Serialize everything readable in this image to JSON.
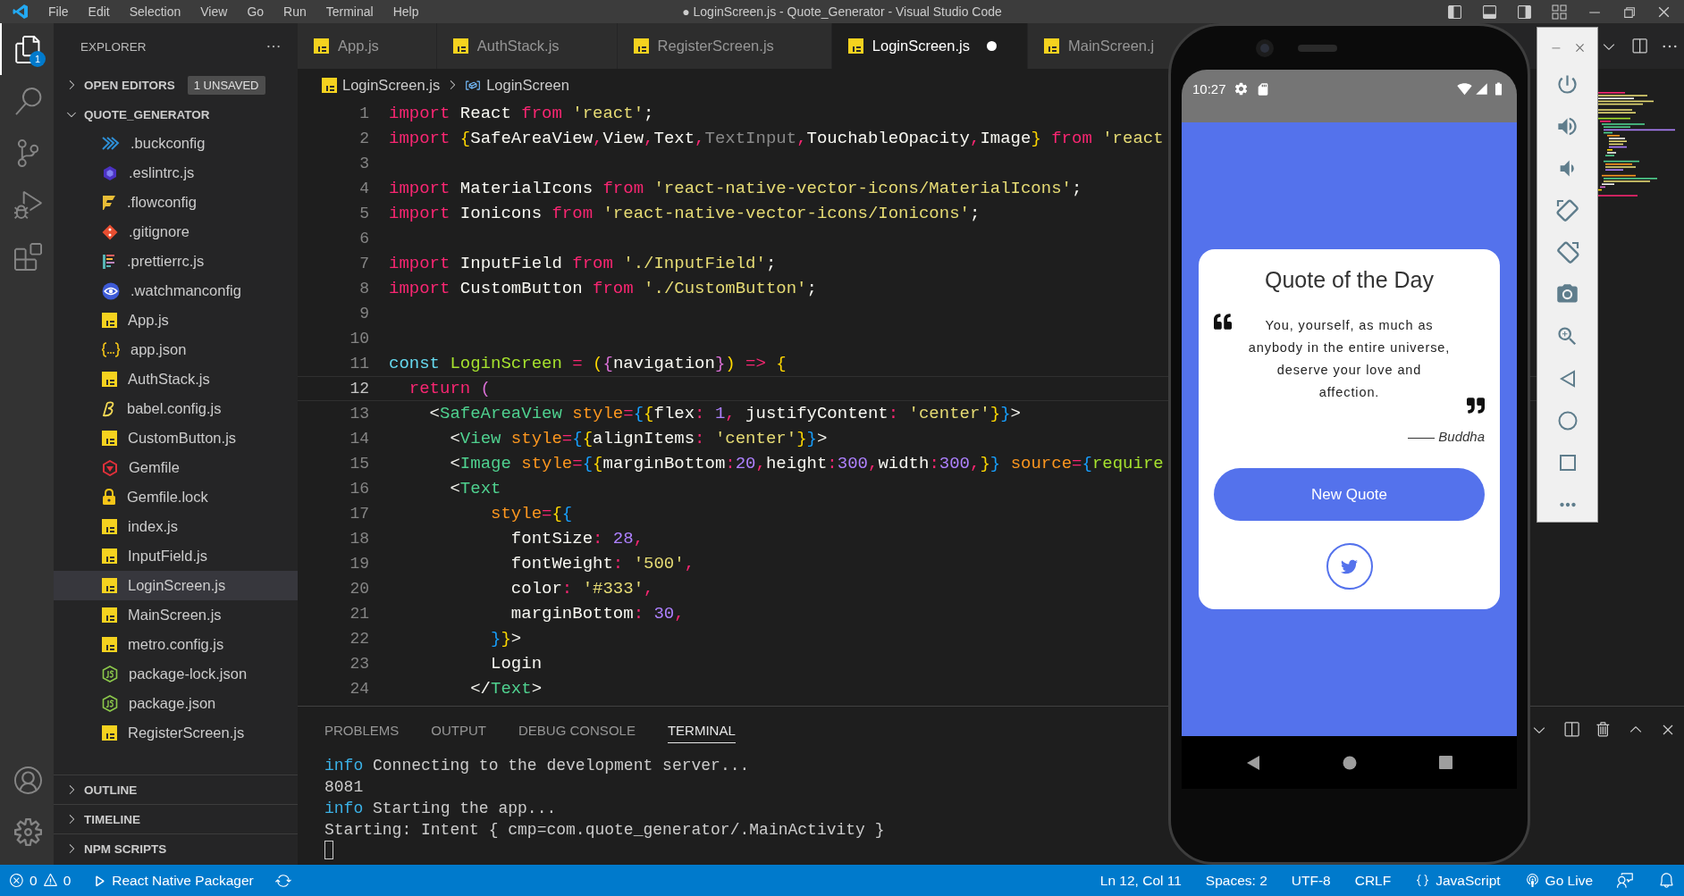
{
  "title_bar": {
    "menu": [
      "File",
      "Edit",
      "Selection",
      "View",
      "Go",
      "Run",
      "Terminal",
      "Help"
    ],
    "title": "● LoginScreen.js - Quote_Generator - Visual Studio Code"
  },
  "activity_bar": {
    "items": [
      {
        "kind": "files",
        "selected": true,
        "badge": "1"
      },
      {
        "kind": "search",
        "selected": false
      },
      {
        "kind": "source-control",
        "selected": false
      },
      {
        "kind": "run",
        "selected": false
      },
      {
        "kind": "extensions",
        "selected": false
      }
    ],
    "bottom": [
      {
        "kind": "account"
      },
      {
        "kind": "settings"
      }
    ]
  },
  "sidebar": {
    "title": "EXPLORER",
    "open_editors": {
      "label": "OPEN EDITORS",
      "expanded": false,
      "badge": "1 UNSAVED"
    },
    "project": {
      "label": "QUOTE_GENERATOR",
      "expanded": true,
      "files": [
        {
          "name": ".buckconfig",
          "kind": "buck",
          "selected": false
        },
        {
          "name": ".eslintrc.js",
          "kind": "eslint",
          "selected": false
        },
        {
          "name": ".flowconfig",
          "kind": "flow",
          "selected": false
        },
        {
          "name": ".gitignore",
          "kind": "git",
          "selected": false
        },
        {
          "name": ".prettierrc.js",
          "kind": "prettier",
          "selected": false
        },
        {
          "name": ".watchmanconfig",
          "kind": "watchman",
          "selected": false
        },
        {
          "name": "App.js",
          "kind": "js",
          "selected": false
        },
        {
          "name": "app.json",
          "kind": "json",
          "selected": false
        },
        {
          "name": "AuthStack.js",
          "kind": "js",
          "selected": false
        },
        {
          "name": "babel.config.js",
          "kind": "babel",
          "selected": false
        },
        {
          "name": "CustomButton.js",
          "kind": "js",
          "selected": false
        },
        {
          "name": "Gemfile",
          "kind": "gem",
          "selected": false
        },
        {
          "name": "Gemfile.lock",
          "kind": "lock",
          "selected": false
        },
        {
          "name": "index.js",
          "kind": "js",
          "selected": false
        },
        {
          "name": "InputField.js",
          "kind": "js",
          "selected": false
        },
        {
          "name": "LoginScreen.js",
          "kind": "js",
          "selected": true
        },
        {
          "name": "MainScreen.js",
          "kind": "js",
          "selected": false
        },
        {
          "name": "metro.config.js",
          "kind": "js",
          "selected": false
        },
        {
          "name": "package-lock.json",
          "kind": "npm",
          "selected": false
        },
        {
          "name": "package.json",
          "kind": "npm",
          "selected": false
        },
        {
          "name": "RegisterScreen.js",
          "kind": "js",
          "selected": false
        }
      ]
    },
    "sections": [
      {
        "label": "OUTLINE",
        "expanded": false
      },
      {
        "label": "TIMELINE",
        "expanded": false
      },
      {
        "label": "NPM SCRIPTS",
        "expanded": false
      }
    ]
  },
  "tabs": [
    {
      "label": "App.js",
      "selected": false,
      "modified": false
    },
    {
      "label": "AuthStack.js",
      "selected": false,
      "modified": false
    },
    {
      "label": "RegisterScreen.js",
      "selected": false,
      "modified": false
    },
    {
      "label": "LoginScreen.js",
      "selected": true,
      "modified": true
    },
    {
      "label": "MainScreen.j",
      "selected": false,
      "modified": false
    }
  ],
  "breadcrumb": [
    {
      "kind": "file",
      "text": "LoginScreen.js"
    },
    {
      "kind": "symbol",
      "text": "LoginScreen"
    }
  ],
  "editor": {
    "lines": [
      {
        "number": "1",
        "current": false,
        "tokens": [
          {
            "kind": "kw",
            "text": "import"
          },
          {
            "kind": "plain",
            "text": " React "
          },
          {
            "kind": "kw",
            "text": "from"
          },
          {
            "kind": "str",
            "text": " 'react'"
          },
          {
            "kind": "plain",
            "text": ";"
          }
        ]
      },
      {
        "number": "2",
        "current": false,
        "tokens": [
          {
            "kind": "kw",
            "text": "import"
          },
          {
            "kind": "b1",
            "text": " {"
          },
          {
            "kind": "plain",
            "text": "SafeAreaView"
          },
          {
            "kind": "kw",
            "text": ","
          },
          {
            "kind": "plain",
            "text": "View"
          },
          {
            "kind": "kw",
            "text": ","
          },
          {
            "kind": "plain",
            "text": "Text"
          },
          {
            "kind": "kw",
            "text": ","
          },
          {
            "kind": "dim",
            "text": "TextInput"
          },
          {
            "kind": "kw",
            "text": ","
          },
          {
            "kind": "plain",
            "text": "TouchableOpacity"
          },
          {
            "kind": "kw",
            "text": ","
          },
          {
            "kind": "plain",
            "text": "Image"
          },
          {
            "kind": "b1",
            "text": "}"
          },
          {
            "kind": "kw",
            "text": " from"
          },
          {
            "kind": "str",
            "text": " 'react"
          }
        ]
      },
      {
        "number": "3",
        "current": false
      },
      {
        "number": "4",
        "current": false,
        "tokens": [
          {
            "kind": "kw",
            "text": "import"
          },
          {
            "kind": "plain",
            "text": " MaterialIcons "
          },
          {
            "kind": "kw",
            "text": "from"
          },
          {
            "kind": "str",
            "text": " 'react-native-vector-icons/MaterialIcons'"
          },
          {
            "kind": "plain",
            "text": ";"
          }
        ]
      },
      {
        "number": "5",
        "current": false,
        "tokens": [
          {
            "kind": "kw",
            "text": "import"
          },
          {
            "kind": "plain",
            "text": " Ionicons "
          },
          {
            "kind": "kw",
            "text": "from"
          },
          {
            "kind": "str",
            "text": " 'react-native-vector-icons/Ionicons'"
          },
          {
            "kind": "plain",
            "text": ";"
          }
        ]
      },
      {
        "number": "6",
        "current": false
      },
      {
        "number": "7",
        "current": false,
        "tokens": [
          {
            "kind": "kw",
            "text": "import"
          },
          {
            "kind": "plain",
            "text": " InputField "
          },
          {
            "kind": "kw",
            "text": "from"
          },
          {
            "kind": "str",
            "text": " './InputField'"
          },
          {
            "kind": "plain",
            "text": ";"
          }
        ]
      },
      {
        "number": "8",
        "current": false,
        "tokens": [
          {
            "kind": "kw",
            "text": "import"
          },
          {
            "kind": "plain",
            "text": " CustomButton "
          },
          {
            "kind": "kw",
            "text": "from"
          },
          {
            "kind": "str",
            "text": " './CustomButton'"
          },
          {
            "kind": "plain",
            "text": ";"
          }
        ]
      },
      {
        "number": "9",
        "current": false
      },
      {
        "number": "10",
        "current": false
      },
      {
        "number": "11",
        "current": false,
        "tokens": [
          {
            "kind": "storage",
            "text": "const"
          },
          {
            "kind": "func",
            "text": " LoginScreen"
          },
          {
            "kind": "kw",
            "text": " ="
          },
          {
            "kind": "b1",
            "text": " ("
          },
          {
            "kind": "b2",
            "text": "{"
          },
          {
            "kind": "plain",
            "text": "navigation"
          },
          {
            "kind": "b2",
            "text": "}"
          },
          {
            "kind": "b1",
            "text": ")"
          },
          {
            "kind": "kw",
            "text": " =>"
          },
          {
            "kind": "b1",
            "text": " {"
          }
        ]
      },
      {
        "number": "12",
        "current": true,
        "tokens": [
          {
            "kind": "kw",
            "text": "  return"
          },
          {
            "kind": "b2",
            "text": " ("
          }
        ]
      },
      {
        "number": "13",
        "current": false,
        "tokens": [
          {
            "kind": "plain",
            "text": "    <"
          },
          {
            "kind": "tag",
            "text": "SafeAreaView"
          },
          {
            "kind": "attr",
            "text": " style"
          },
          {
            "kind": "kw",
            "text": "="
          },
          {
            "kind": "b3",
            "text": "{"
          },
          {
            "kind": "b1",
            "text": "{"
          },
          {
            "kind": "plain",
            "text": "flex"
          },
          {
            "kind": "kw",
            "text": ":"
          },
          {
            "kind": "num",
            "text": " 1"
          },
          {
            "kind": "kw",
            "text": ","
          },
          {
            "kind": "plain",
            "text": " justifyContent"
          },
          {
            "kind": "kw",
            "text": ":"
          },
          {
            "kind": "str",
            "text": " 'center'"
          },
          {
            "kind": "b1",
            "text": "}"
          },
          {
            "kind": "b3",
            "text": "}"
          },
          {
            "kind": "plain",
            "text": ">"
          }
        ]
      },
      {
        "number": "14",
        "current": false,
        "tokens": [
          {
            "kind": "plain",
            "text": "      <"
          },
          {
            "kind": "tag",
            "text": "View"
          },
          {
            "kind": "attr",
            "text": " style"
          },
          {
            "kind": "kw",
            "text": "="
          },
          {
            "kind": "b3",
            "text": "{"
          },
          {
            "kind": "b1",
            "text": "{"
          },
          {
            "kind": "plain",
            "text": "alignItems"
          },
          {
            "kind": "kw",
            "text": ":"
          },
          {
            "kind": "str",
            "text": " 'center'"
          },
          {
            "kind": "b1",
            "text": "}"
          },
          {
            "kind": "b3",
            "text": "}"
          },
          {
            "kind": "plain",
            "text": ">"
          }
        ]
      },
      {
        "number": "15",
        "current": false,
        "tokens": [
          {
            "kind": "plain",
            "text": "      <"
          },
          {
            "kind": "tag",
            "text": "Image"
          },
          {
            "kind": "attr",
            "text": " style"
          },
          {
            "kind": "kw",
            "text": "="
          },
          {
            "kind": "b3",
            "text": "{"
          },
          {
            "kind": "b1",
            "text": "{"
          },
          {
            "kind": "plain",
            "text": "marginBottom"
          },
          {
            "kind": "kw",
            "text": ":"
          },
          {
            "kind": "num",
            "text": "20"
          },
          {
            "kind": "kw",
            "text": ","
          },
          {
            "kind": "plain",
            "text": "height"
          },
          {
            "kind": "kw",
            "text": ":"
          },
          {
            "kind": "num",
            "text": "300"
          },
          {
            "kind": "kw",
            "text": ","
          },
          {
            "kind": "plain",
            "text": "width"
          },
          {
            "kind": "kw",
            "text": ":"
          },
          {
            "kind": "num",
            "text": "300"
          },
          {
            "kind": "kw",
            "text": ","
          },
          {
            "kind": "b1",
            "text": "}"
          },
          {
            "kind": "b3",
            "text": "}"
          },
          {
            "kind": "attr",
            "text": " source"
          },
          {
            "kind": "kw",
            "text": "="
          },
          {
            "kind": "b3",
            "text": "{"
          },
          {
            "kind": "func",
            "text": "require"
          }
        ]
      },
      {
        "number": "16",
        "current": false,
        "tokens": [
          {
            "kind": "plain",
            "text": "      <"
          },
          {
            "kind": "tag",
            "text": "Text"
          }
        ]
      },
      {
        "number": "17",
        "current": false,
        "tokens": [
          {
            "kind": "attr",
            "text": "          style"
          },
          {
            "kind": "kw",
            "text": "="
          },
          {
            "kind": "b1",
            "text": "{"
          },
          {
            "kind": "b3",
            "text": "{"
          }
        ]
      },
      {
        "number": "18",
        "current": false,
        "tokens": [
          {
            "kind": "plain",
            "text": "            fontSize"
          },
          {
            "kind": "kw",
            "text": ":"
          },
          {
            "kind": "num",
            "text": " 28"
          },
          {
            "kind": "kw",
            "text": ","
          }
        ]
      },
      {
        "number": "19",
        "current": false,
        "tokens": [
          {
            "kind": "plain",
            "text": "            fontWeight"
          },
          {
            "kind": "kw",
            "text": ":"
          },
          {
            "kind": "str",
            "text": " '500'"
          },
          {
            "kind": "kw",
            "text": ","
          }
        ]
      },
      {
        "number": "20",
        "current": false,
        "tokens": [
          {
            "kind": "plain",
            "text": "            color"
          },
          {
            "kind": "kw",
            "text": ":"
          },
          {
            "kind": "str",
            "text": " '#333'"
          },
          {
            "kind": "kw",
            "text": ","
          }
        ]
      },
      {
        "number": "21",
        "current": false,
        "tokens": [
          {
            "kind": "plain",
            "text": "            marginBottom"
          },
          {
            "kind": "kw",
            "text": ":"
          },
          {
            "kind": "num",
            "text": " 30"
          },
          {
            "kind": "kw",
            "text": ","
          }
        ]
      },
      {
        "number": "22",
        "current": false,
        "tokens": [
          {
            "kind": "b3",
            "text": "          }"
          },
          {
            "kind": "b1",
            "text": "}"
          },
          {
            "kind": "plain",
            "text": ">"
          }
        ]
      },
      {
        "number": "23",
        "current": false,
        "tokens": [
          {
            "kind": "plain",
            "text": "          Login"
          }
        ]
      },
      {
        "number": "24",
        "current": false,
        "tokens": [
          {
            "kind": "plain",
            "text": "        </"
          },
          {
            "kind": "tag",
            "text": "Text"
          },
          {
            "kind": "plain",
            "text": ">"
          }
        ]
      }
    ]
  },
  "panel": {
    "tabs": [
      {
        "label": "PROBLEMS",
        "selected": false
      },
      {
        "label": "OUTPUT",
        "selected": false
      },
      {
        "label": "DEBUG CONSOLE",
        "selected": false
      },
      {
        "label": "TERMINAL",
        "selected": true
      }
    ],
    "terminal": [
      {
        "tokens": [
          {
            "kind": "info",
            "text": "info"
          },
          {
            "kind": "plain",
            "text": " Connecting to the development server..."
          }
        ]
      },
      {
        "tokens": [
          {
            "kind": "plain",
            "text": "8081"
          }
        ]
      },
      {
        "tokens": [
          {
            "kind": "info",
            "text": "info"
          },
          {
            "kind": "plain",
            "text": " Starting the app..."
          }
        ]
      },
      {
        "tokens": [
          {
            "kind": "plain",
            "text": "Starting: Intent { cmp=com.quote_generator/.MainActivity }"
          }
        ]
      }
    ]
  },
  "status_bar": {
    "errors": "0",
    "warnings": "0",
    "task": "React Native Packager",
    "right": [
      {
        "kind": "text",
        "text": "Ln 12, Col 11"
      },
      {
        "kind": "text",
        "text": "Spaces: 2"
      },
      {
        "kind": "text",
        "text": "UTF-8"
      },
      {
        "kind": "text",
        "text": "CRLF"
      },
      {
        "kind": "language",
        "text": "JavaScript"
      },
      {
        "kind": "live",
        "text": "Go Live"
      },
      {
        "kind": "feedback"
      },
      {
        "kind": "bell"
      }
    ]
  },
  "phone": {
    "time": "10:27",
    "app": {
      "title": "Quote of the Day",
      "quote": "You, yourself, as much as\nanybody in the entire universe,\ndeserve your love and\naffection.",
      "author": "—— *Buddha*",
      "button": "New Quote"
    }
  }
}
